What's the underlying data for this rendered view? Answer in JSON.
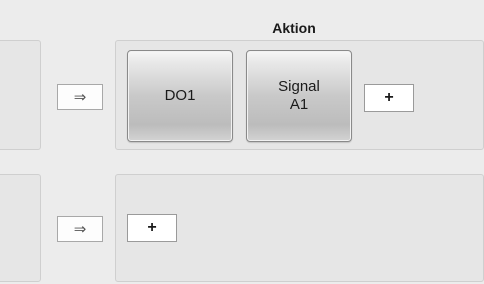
{
  "header": {
    "title": "Aktion"
  },
  "rows": [
    {
      "arrow_symbol": "⇒",
      "actions": [
        {
          "label": "DO1"
        },
        {
          "label_line1": "Signal",
          "label_line2": "A1"
        }
      ],
      "add_label": "+"
    },
    {
      "arrow_symbol": "⇒",
      "actions": [],
      "add_label": "+"
    }
  ]
}
